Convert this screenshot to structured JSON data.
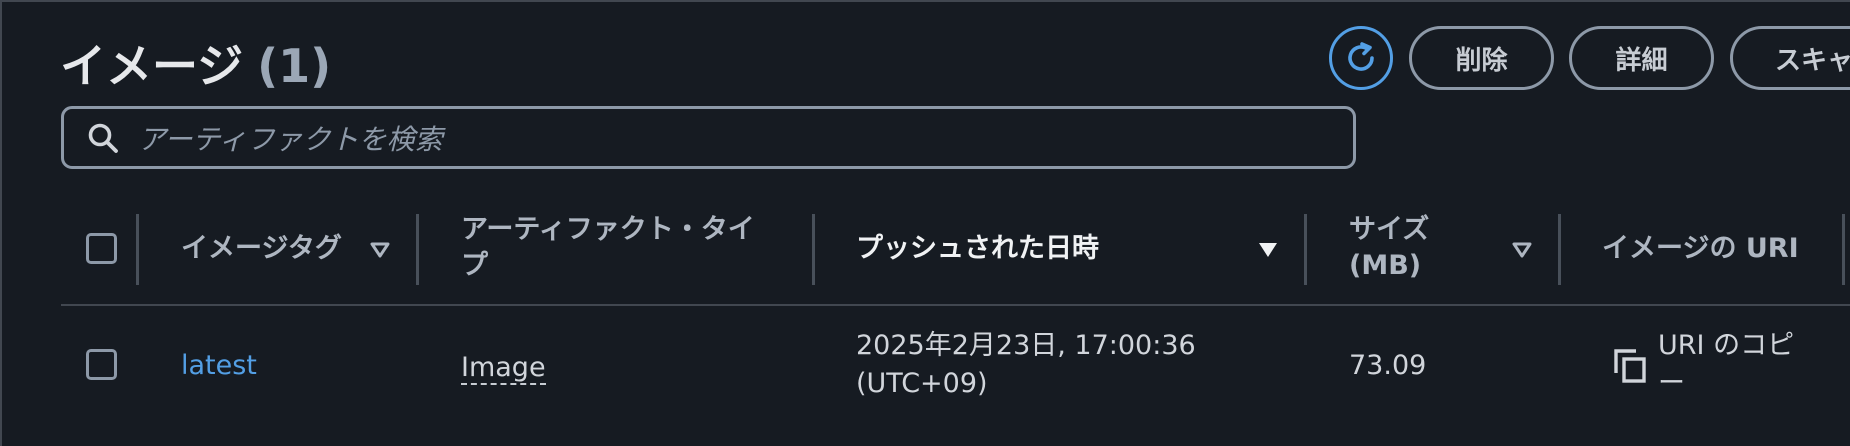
{
  "header": {
    "title": "イメージ",
    "count": "(1)"
  },
  "actions": {
    "refresh_icon": "refresh-icon",
    "delete_label": "削除",
    "detail_label": "詳細",
    "scan_label": "スキャ"
  },
  "search": {
    "placeholder": "アーティファクトを検索"
  },
  "table": {
    "columns": {
      "tag": "イメージタグ",
      "artifact_type_line1": "アーティファクト・タイ",
      "artifact_type_line2": "プ",
      "pushed_at": "プッシュされた日時",
      "size_line1": "サイズ",
      "size_line2": "(MB)",
      "uri": "イメージの URI"
    },
    "rows": [
      {
        "tag": "latest",
        "artifact_type": "Image",
        "pushed_line1": "2025年2月23日, 17:00:36",
        "pushed_line2": "(UTC+09)",
        "size": "73.09",
        "uri_line1": "URI のコピ",
        "uri_line2": "ー"
      }
    ]
  },
  "colors": {
    "background": "#161b22",
    "link": "#539fe5",
    "border": "#8d99a8"
  }
}
